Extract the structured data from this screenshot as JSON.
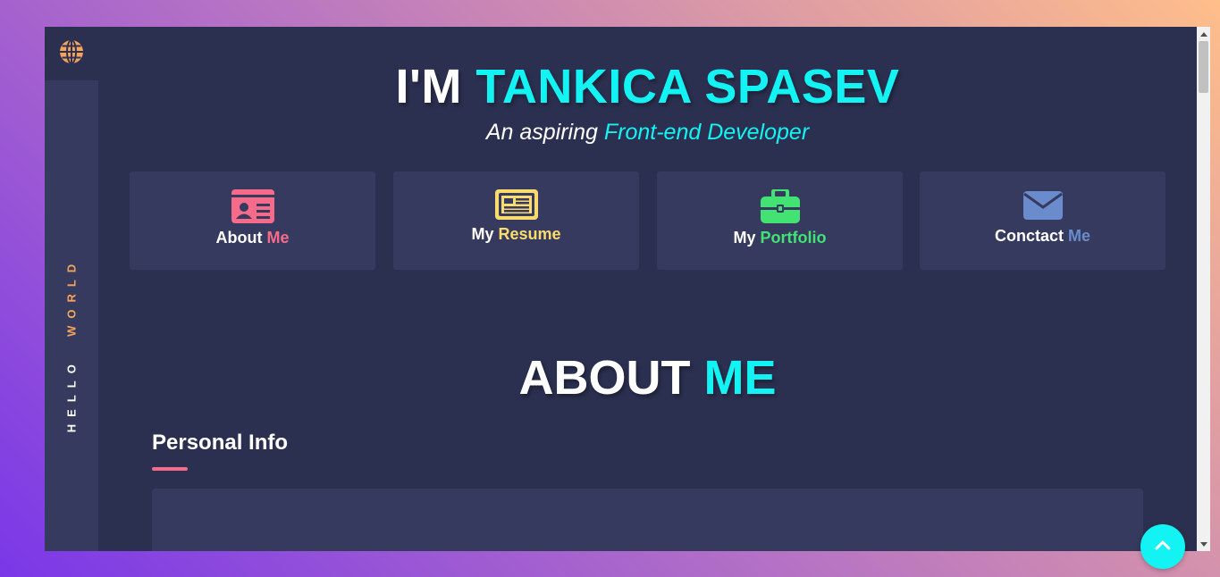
{
  "sidebar": {
    "logo_icon": "globe-icon",
    "vertical_text_first": "HELLO",
    "vertical_text_second": "WORLD"
  },
  "hero": {
    "title_prefix": "I'M",
    "title_name": "TANKICA SPASEV",
    "subtitle_prefix": "An aspiring",
    "subtitle_role": "Front-end Developer"
  },
  "nav_cards": [
    {
      "icon": "id-card-icon",
      "label_first": "About",
      "label_second": "Me",
      "accent": "#f76b8a"
    },
    {
      "icon": "newspaper-icon",
      "label_first": "My",
      "label_second": "Resume",
      "accent": "#fcdb6d"
    },
    {
      "icon": "toolbox-icon",
      "label_first": "My",
      "label_second": "Portfolio",
      "accent": "#42e373"
    },
    {
      "icon": "envelope-icon",
      "label_first": "Conctact",
      "label_second": "Me",
      "accent": "#6a8ccc"
    }
  ],
  "section": {
    "title_first": "ABOUT",
    "title_second": "ME",
    "subheading": "Personal Info"
  },
  "colors": {
    "background": "#2c3050",
    "panel": "#363a5e",
    "accent": "#13f3f3",
    "orange": "#f6a35f"
  },
  "back_to_top_icon": "chevron-up-icon"
}
